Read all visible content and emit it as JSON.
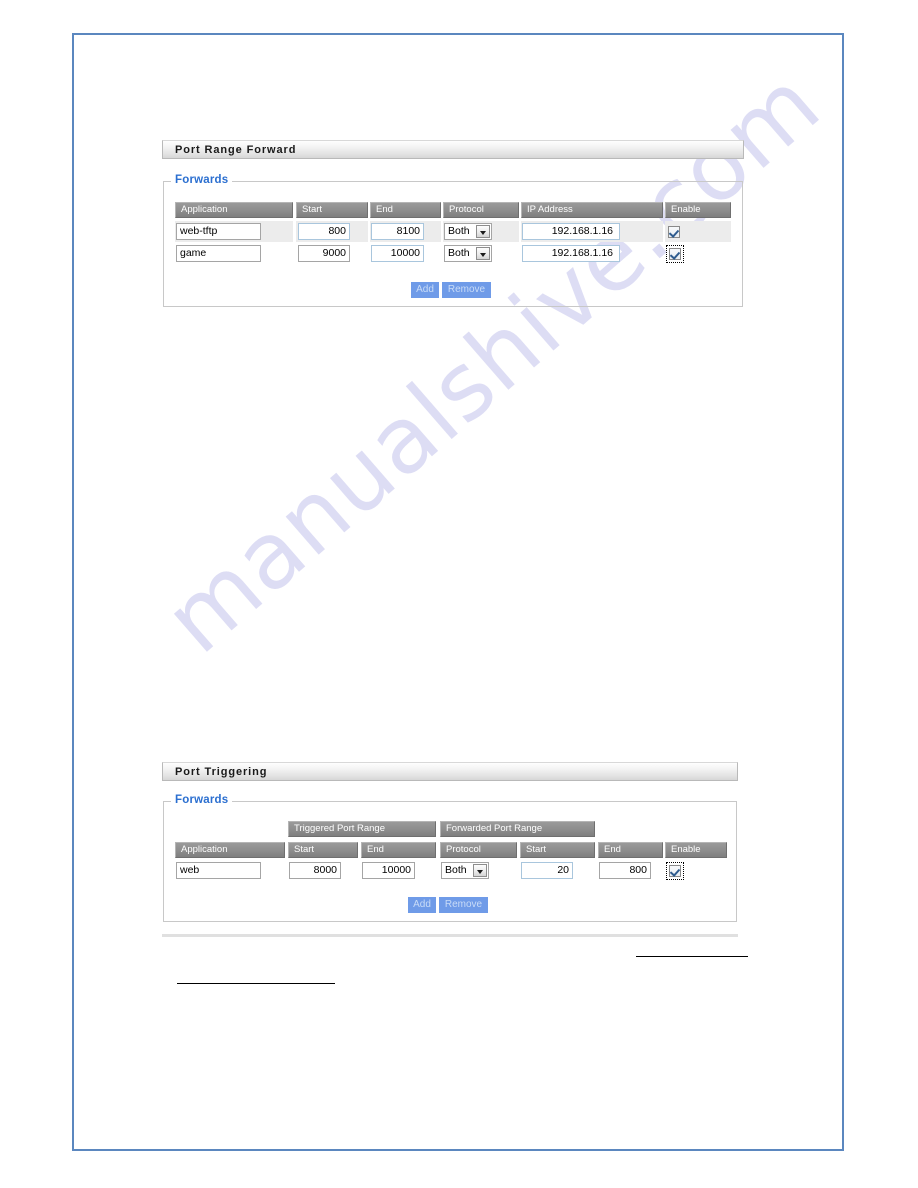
{
  "page": {
    "watermark_text": "manualshive.com",
    "border_color": "#5b87bf"
  },
  "sections": [
    {
      "id": "port-range-forward",
      "title": "Port Range Forward",
      "legend": "Forwards",
      "columns": [
        "Application",
        "Start",
        "End",
        "Protocol",
        "IP Address",
        "Enable"
      ],
      "rows": [
        {
          "application": "web-tftp",
          "start": "800",
          "end": "8100",
          "protocol": "Both",
          "ip_address": "192.168.1.16",
          "enable": true,
          "enable_focused": false
        },
        {
          "application": "game",
          "start": "9000",
          "end": "10000",
          "protocol": "Both",
          "ip_address": "192.168.1.16",
          "enable": true,
          "enable_focused": true
        }
      ],
      "buttons": {
        "add": "Add",
        "remove": "Remove"
      }
    },
    {
      "id": "port-triggering",
      "title": "Port Triggering",
      "legend": "Forwards",
      "group_headers": [
        "Triggered Port Range",
        "Forwarded Port Range"
      ],
      "columns": [
        "Application",
        "Start",
        "End",
        "Protocol",
        "Start",
        "End",
        "Enable"
      ],
      "rows": [
        {
          "application": "web",
          "triggered_start": "8000",
          "triggered_end": "10000",
          "protocol": "Both",
          "forwarded_start": "20",
          "forwarded_end": "800",
          "enable": true,
          "enable_focused": true
        }
      ],
      "buttons": {
        "add": "Add",
        "remove": "Remove"
      }
    }
  ]
}
